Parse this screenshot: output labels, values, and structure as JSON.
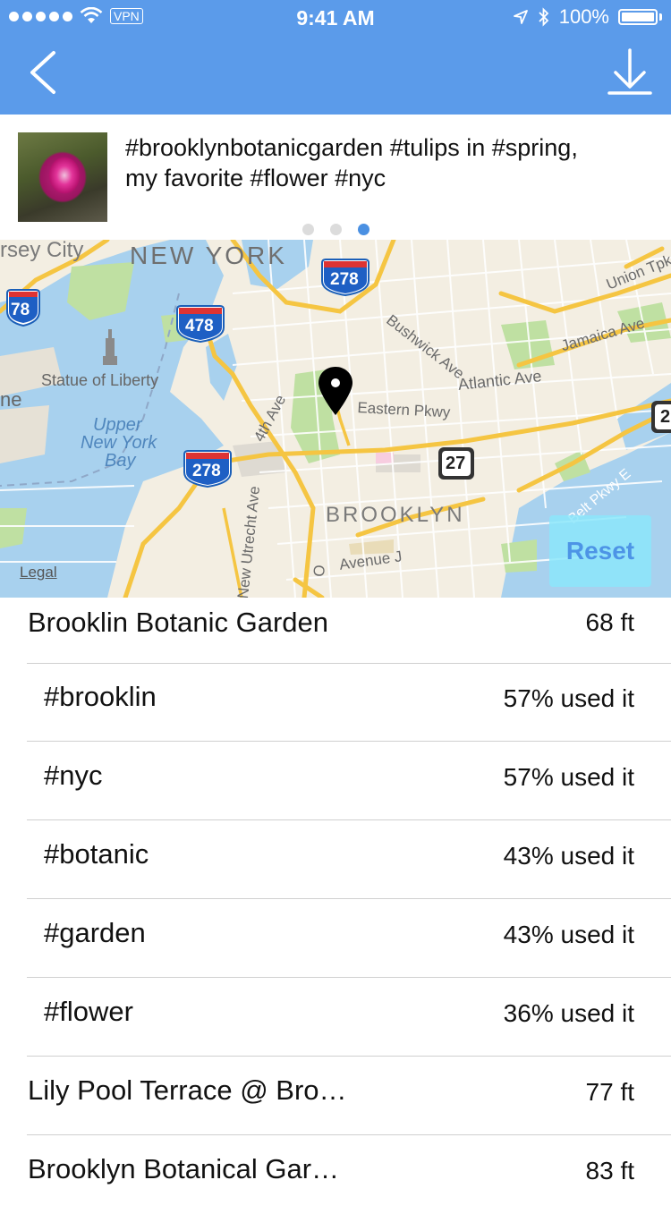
{
  "status_bar": {
    "carrier_signal": "signal-dots",
    "vpn": "VPN",
    "time": "9:41 AM",
    "battery": "100%"
  },
  "nav": {
    "back_icon": "chevron-left-icon",
    "download_icon": "download-icon"
  },
  "post": {
    "caption_line1": "#brooklynbotanicgarden #tulips in #spring,",
    "caption_line2": "my favorite #flower #nyc",
    "pager_count": 3,
    "pager_active": 3
  },
  "map": {
    "labels": {
      "jersey_city": "rsey City",
      "new_york": "NEW YORK",
      "statue": "Statue of Liberty",
      "upper_bay_1": "Upper",
      "upper_bay_2": "New York",
      "upper_bay_3": "Bay",
      "bushwick": "Bushwick Ave",
      "jamaica": "Jamaica Ave",
      "union": "Union Tpk",
      "atlantic": "Atlantic Ave",
      "eastern": "Eastern Pkwy",
      "fourth_ave": "4th Ave",
      "utrecht": "New Utrecht Ave",
      "avenue_j": "Avenue J",
      "brooklyn": "BROOKLYN",
      "belt": "Belt Pkwy E",
      "ne": "ne",
      "o": "O"
    },
    "shields": {
      "i78": "78",
      "i278_top": "278",
      "i478": "478",
      "i278_bottom": "278",
      "ny27": "27",
      "right_edge": "2"
    },
    "reset": "Reset",
    "legal": "Legal"
  },
  "places": [
    {
      "name": "Brooklin Botanic Garden",
      "distance": "68 ft"
    },
    {
      "name": "Lily Pool Terrace @ Bro…",
      "distance": "77 ft"
    },
    {
      "name": "Brooklyn Botanical Gar…",
      "distance": "83 ft"
    }
  ],
  "tags": [
    {
      "name": "#brooklin",
      "usage": "57% used it"
    },
    {
      "name": "#nyc",
      "usage": "57% used it"
    },
    {
      "name": "#botanic",
      "usage": "43% used it"
    },
    {
      "name": "#garden",
      "usage": "43% used it"
    },
    {
      "name": "#flower",
      "usage": "36% used it"
    }
  ],
  "colors": {
    "header": "#5b9bea",
    "water": "#a8d1ee",
    "park": "#bfe0a2",
    "land": "#f3eee2",
    "highway": "#f5c542",
    "reset_bg": "#8ce6fa",
    "pager_active": "#4a90e2"
  }
}
